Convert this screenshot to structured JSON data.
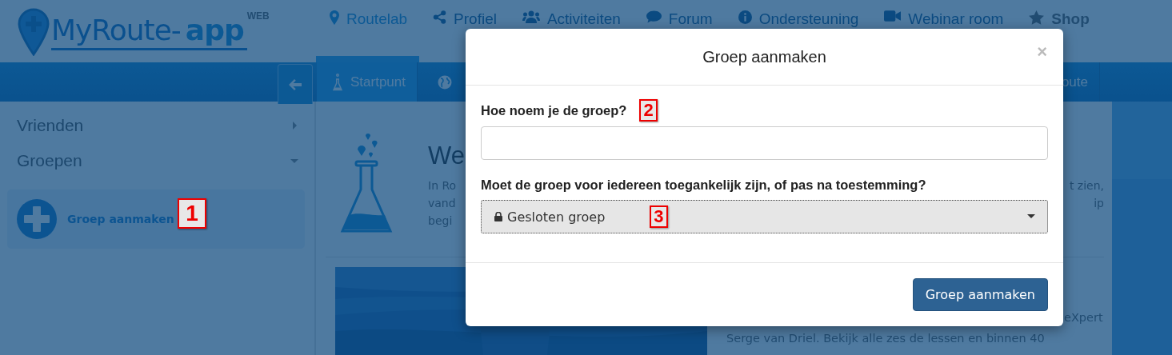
{
  "logo": {
    "name": "MyRoute-",
    "accent": "app",
    "badge": "WEB"
  },
  "nav": [
    {
      "label": "Routelab",
      "kind": "marker",
      "selected": true
    },
    {
      "label": "Profiel",
      "kind": "share",
      "selected": false
    },
    {
      "label": "Activiteiten",
      "kind": "users",
      "selected": false
    },
    {
      "label": "Forum",
      "kind": "chat",
      "selected": false
    },
    {
      "label": "Ondersteuning",
      "kind": "info",
      "selected": false
    },
    {
      "label": "Webinar room",
      "kind": "video",
      "selected": false
    },
    {
      "label": "Shop",
      "kind": "star",
      "selected": false
    }
  ],
  "tabs": [
    {
      "label": "Startpunt",
      "kind": "flask",
      "selected": true
    },
    {
      "kind": "globe",
      "selected": false
    },
    {
      "label": "oute",
      "kind": "text",
      "selected": false
    }
  ],
  "sidebar": {
    "items": [
      {
        "label": "Vrienden",
        "expanded": false
      },
      {
        "label": "Groepen",
        "expanded": true
      }
    ],
    "create_button": "Groep aanmaken"
  },
  "main": {
    "heading": "We",
    "intro_left": [
      "In Ro",
      "vand",
      "begi"
    ],
    "intro_right": [
      "t zien,",
      "ip"
    ],
    "lesson_lines": [
      "eXpert",
      "Serge van Driel. Bekijk alle zes de lessen en binnen 40"
    ]
  },
  "modal": {
    "title": "Groep aanmaken",
    "close": "×",
    "name_label": "Hoe noem je de groep?",
    "access_label": "Moet de groep voor iedereen toegankelijk zijn, of pas na toestemming?",
    "access_value": "Gesloten groep",
    "submit": "Groep aanmaken"
  },
  "annotations": [
    "1",
    "2",
    "3"
  ]
}
